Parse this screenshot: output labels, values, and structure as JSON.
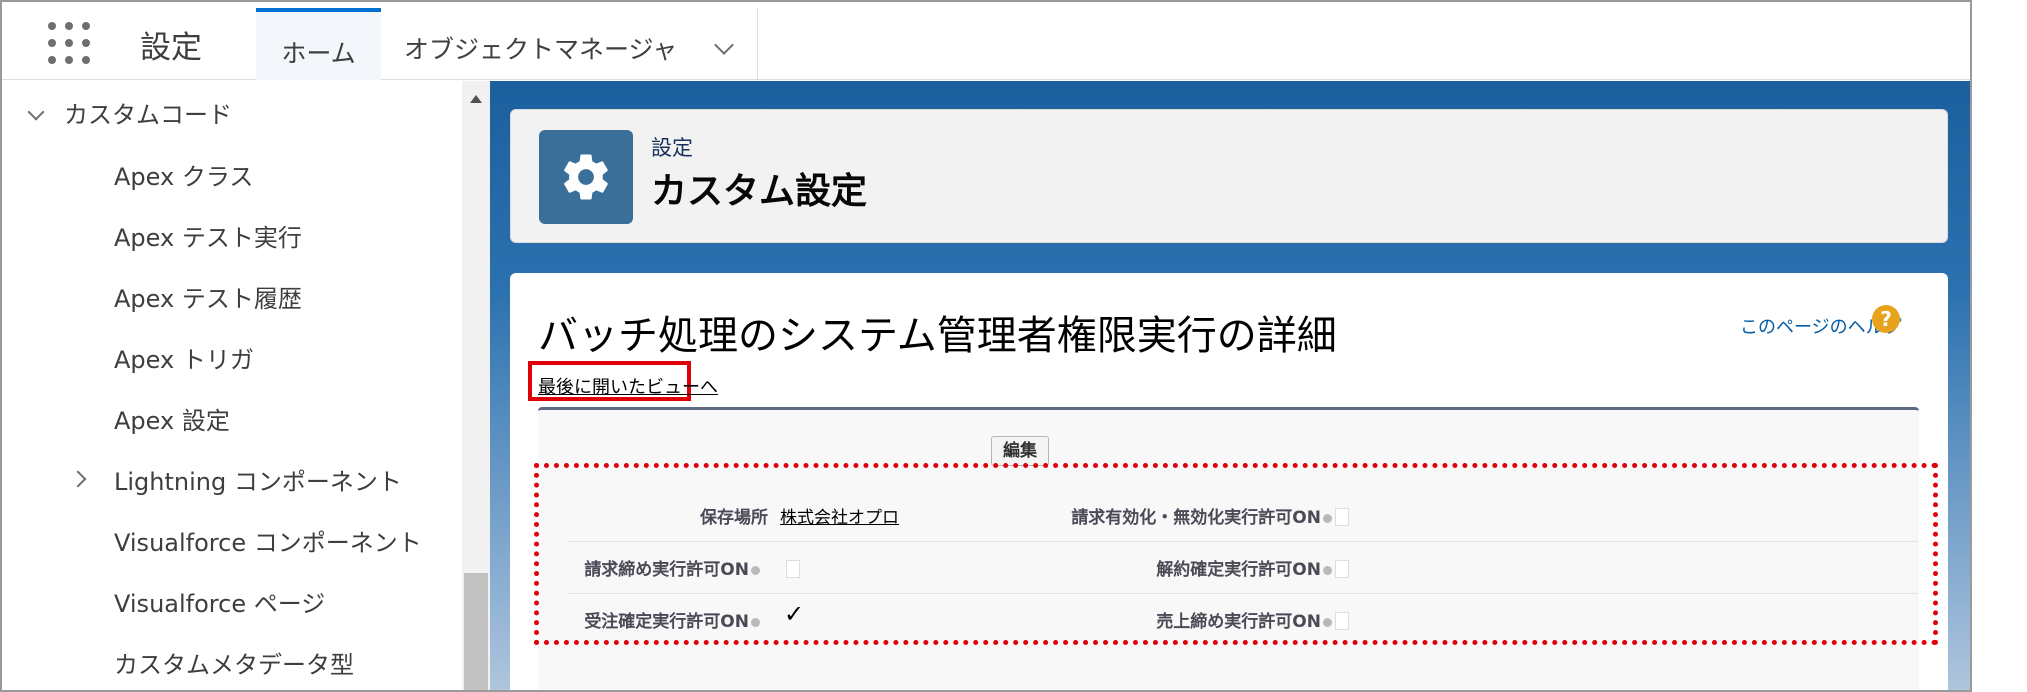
{
  "topbar": {
    "app_title": "設定",
    "tab_home": "ホーム",
    "tab_object_manager": "オブジェクトマネージャ"
  },
  "sidebar": {
    "section": "カスタムコード",
    "items": [
      {
        "label": "Apex クラス"
      },
      {
        "label": "Apex テスト実行"
      },
      {
        "label": "Apex テスト履歴"
      },
      {
        "label": "Apex トリガ"
      },
      {
        "label": "Apex 設定"
      },
      {
        "label": "Lightning コンポーネント"
      },
      {
        "label": "Visualforce コンポーネント"
      },
      {
        "label": "Visualforce ページ"
      },
      {
        "label": "カスタムメタデータ型"
      }
    ]
  },
  "header": {
    "subtitle": "設定",
    "title": "カスタム設定",
    "icon": "gear-icon"
  },
  "detail": {
    "title": "バッチ処理のシステム管理者権限実行の詳細",
    "help_link": "このページのヘルプ",
    "back_link": "最後に開いたビューへ",
    "edit_button": "編集",
    "fields": {
      "location_label": "保存場所",
      "location_value": "株式会社オプロ",
      "billing_toggle_label": "請求有効化・無効化実行許可ON",
      "billing_toggle_checked": false,
      "billing_close_label": "請求締め実行許可ON",
      "billing_close_checked": false,
      "cancel_confirm_label": "解約確定実行許可ON",
      "cancel_confirm_checked": false,
      "order_confirm_label": "受注確定実行許可ON",
      "order_confirm_checked": true,
      "sales_close_label": "売上締め実行許可ON",
      "sales_close_checked": false
    }
  },
  "colors": {
    "highlight": "#e0000a",
    "brand_blue": "#0070d2",
    "help_orange": "#e8a31c"
  }
}
